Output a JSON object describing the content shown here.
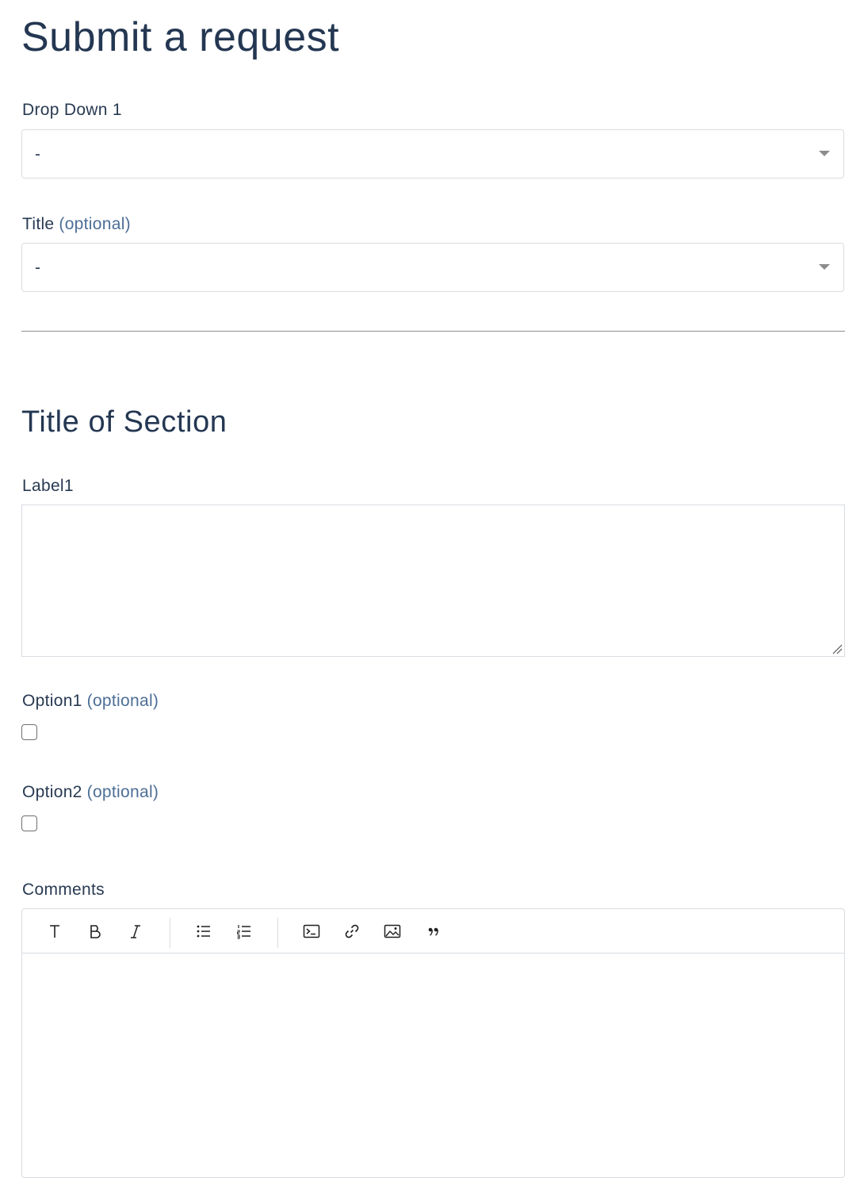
{
  "page": {
    "title": "Submit a request"
  },
  "form": {
    "dropdown1": {
      "label": "Drop Down 1",
      "value": "-"
    },
    "title_field": {
      "label": "Title",
      "optional": "(optional)",
      "value": "-"
    },
    "section": {
      "title": "Title of Section"
    },
    "label1": {
      "label": "Label1",
      "value": ""
    },
    "option1": {
      "label": "Option1",
      "optional": "(optional)",
      "checked": false
    },
    "option2": {
      "label": "Option2",
      "optional": "(optional)",
      "checked": false
    },
    "comments": {
      "label": "Comments",
      "value": "",
      "toolbar": [
        {
          "name": "text-format",
          "icon": "text-icon"
        },
        {
          "name": "bold",
          "icon": "bold-icon"
        },
        {
          "name": "italic",
          "icon": "italic-icon"
        },
        {
          "name": "bulleted-list",
          "icon": "bulleted-list-icon"
        },
        {
          "name": "numbered-list",
          "icon": "numbered-list-icon"
        },
        {
          "name": "code-block",
          "icon": "code-block-icon"
        },
        {
          "name": "link",
          "icon": "link-icon"
        },
        {
          "name": "image",
          "icon": "image-icon"
        },
        {
          "name": "quote",
          "icon": "quote-icon"
        }
      ]
    }
  },
  "colors": {
    "heading": "#243752",
    "text": "#283a52",
    "optional": "#4d6e96",
    "border": "#d8dce1",
    "divider": "#8f8f8f"
  }
}
